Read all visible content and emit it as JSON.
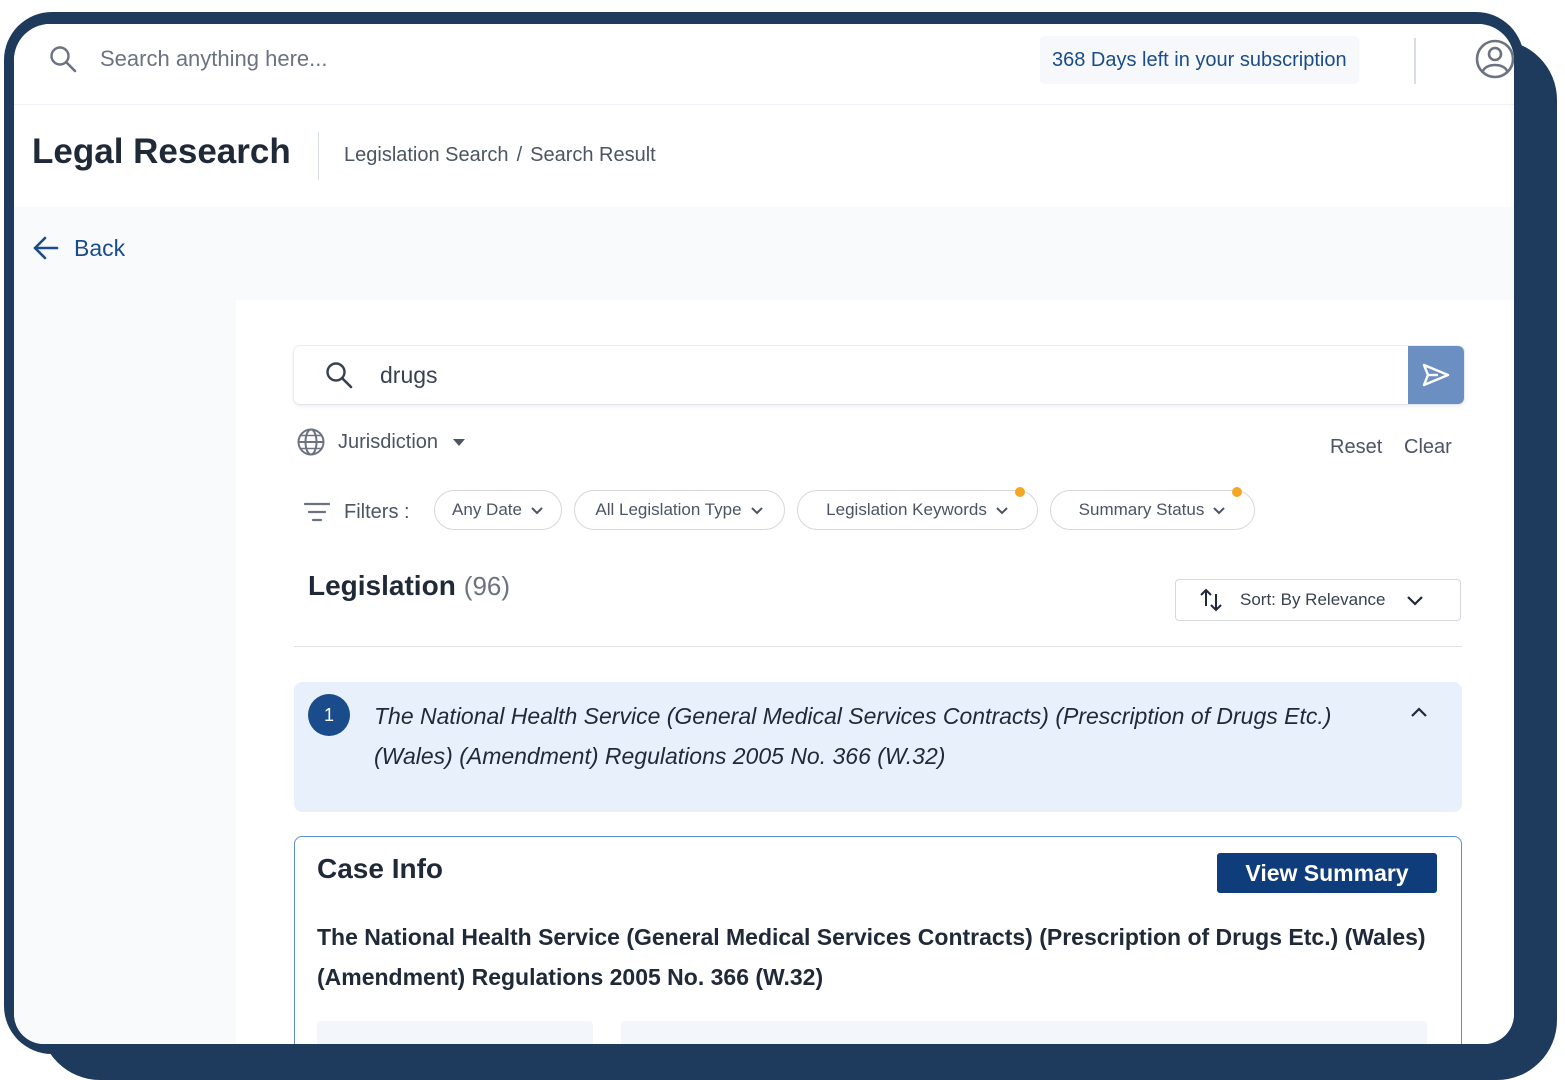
{
  "topbar": {
    "search_placeholder": "Search anything here...",
    "subscription": "368 Days left in your subscription"
  },
  "header": {
    "title": "Legal Research",
    "breadcrumb": [
      "Legislation Search",
      "Search Result"
    ],
    "breadcrumb_sep": "/"
  },
  "back_label": "Back",
  "search": {
    "value": "drugs",
    "jurisdiction_label": "Jurisdiction",
    "reset_label": "Reset",
    "clear_label": "Clear"
  },
  "filters": {
    "label": "Filters :",
    "chips": [
      "Any Date",
      "All Legislation Type",
      "Legislation Keywords",
      "Summary Status"
    ]
  },
  "results": {
    "title": "Legislation",
    "count": "(96)",
    "sort_label": "Sort: By Relevance",
    "items": [
      {
        "number": "1",
        "title": "The National Health Service (General Medical Services Contracts) (Prescription of Drugs Etc.) (Wales) (Amendment) Regulations 2005 No. 366 (W.32)"
      }
    ]
  },
  "case_info": {
    "title": "Case Info",
    "view_summary_label": "View Summary",
    "text": "The National Health Service (General Medical Services Contracts) (Prescription of Drugs Etc.) (Wales) (Amendment) Regulations 2005 No. 366 (W.32)"
  },
  "colors": {
    "frame": "#1e3a5c",
    "accent": "#1a4c8b",
    "button": "#0f3c7a",
    "send": "#6b8fc0",
    "result_bg": "#e8f1fb",
    "dot": "#f5a623"
  },
  "icons": {
    "top_search": "search-icon",
    "avatar": "user-circle-icon",
    "back": "arrow-left-icon",
    "send": "send-icon",
    "jurisdiction": "globe-icon",
    "filters": "filter-icon",
    "sort": "sort-arrows-icon",
    "collapse": "chevron-up-icon"
  }
}
